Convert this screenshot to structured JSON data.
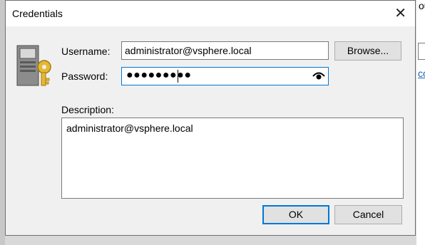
{
  "background": {
    "partial_text": "ou",
    "partial_link": "cc"
  },
  "dialog": {
    "title": "Credentials",
    "close_glyph": "✕",
    "icon": "credentials-key-icon",
    "username_label": "Username:",
    "username_value": "administrator@vsphere.local",
    "browse_label": "Browse...",
    "password_label": "Password:",
    "password_mask": "●●●●●●●●●",
    "show_password_icon": "eye-icon",
    "description_label": "Description:",
    "description_value": "administrator@vsphere.local",
    "ok_label": "OK",
    "cancel_label": "Cancel"
  },
  "colors": {
    "focus": "#0078d7",
    "dialog_bg": "#f0f0f0",
    "key": "#e6b833"
  }
}
